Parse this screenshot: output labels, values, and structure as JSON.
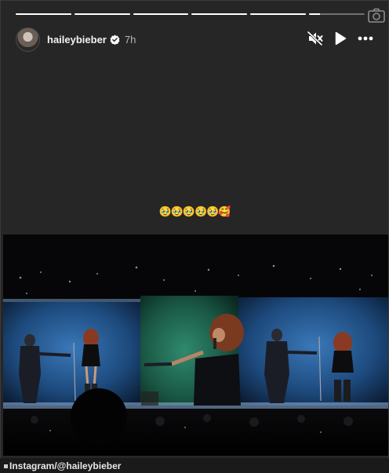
{
  "story": {
    "progress": [
      1,
      1,
      1,
      1,
      1,
      0.2
    ],
    "username": "haileybieber",
    "time": "7h",
    "verified": true,
    "caption": "🥹🥹🥹🥹🥹🥰",
    "muted": true
  },
  "icons": {
    "camera": "camera-icon",
    "mute": "speaker-muted-icon",
    "play": "play-icon",
    "more": "more-horizontal-icon",
    "verified": "verified-badge-icon"
  },
  "footer": {
    "credit": "Instagram/@haileybieber"
  },
  "colors": {
    "background": "#262626",
    "stage_blue": "#1f4f86",
    "stage_green": "#1b5c48"
  }
}
